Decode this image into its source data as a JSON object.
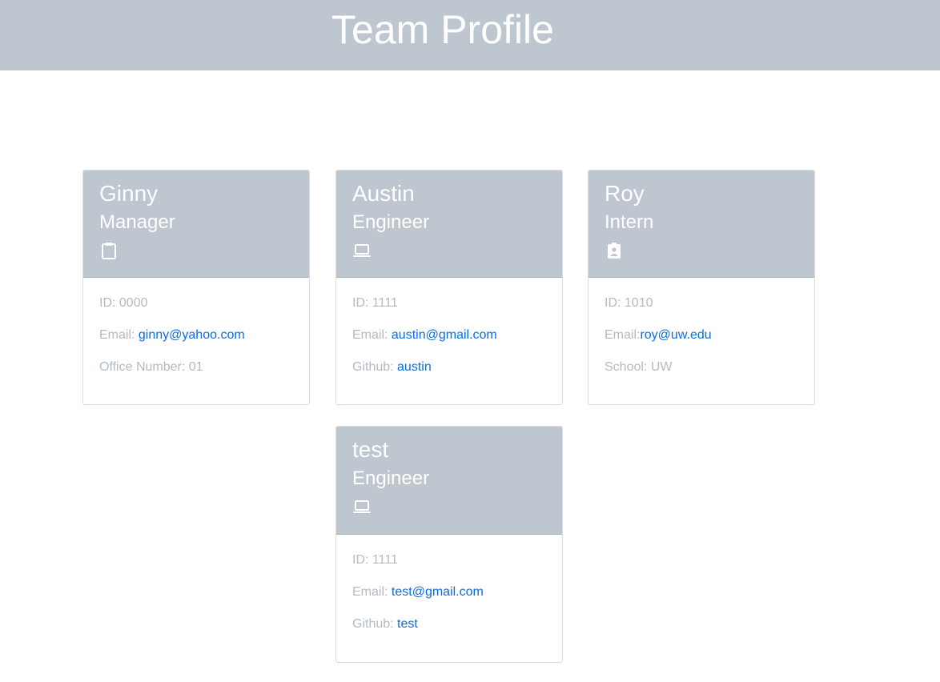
{
  "page": {
    "title": "Team Profile"
  },
  "colors": {
    "header_bg": "#bec6cf",
    "link": "#0a6ee0",
    "muted_text": "#b3bac3"
  },
  "cards": [
    {
      "name": "Ginny",
      "role": "Manager",
      "icon": "clipboard-icon",
      "id_label": "ID: 0000",
      "email_label": "Email: ",
      "email": "ginny@yahoo.com",
      "extra_label": "Office Number: 01",
      "extra_link": ""
    },
    {
      "name": "Austin",
      "role": "Engineer",
      "icon": "laptop-icon",
      "id_label": "ID: 1111",
      "email_label": "Email: ",
      "email": "austin@gmail.com",
      "extra_label": "Github: ",
      "extra_link": "austin"
    },
    {
      "name": "Roy",
      "role": "Intern",
      "icon": "id-badge-icon",
      "id_label": "ID: 1010",
      "email_label": "Email:",
      "email": "roy@uw.edu",
      "extra_label": "School: UW",
      "extra_link": ""
    },
    {
      "name": "test",
      "role": "Engineer",
      "icon": "laptop-icon",
      "id_label": "ID: 1111",
      "email_label": "Email: ",
      "email": "test@gmail.com",
      "extra_label": "Github: ",
      "extra_link": "test"
    }
  ]
}
